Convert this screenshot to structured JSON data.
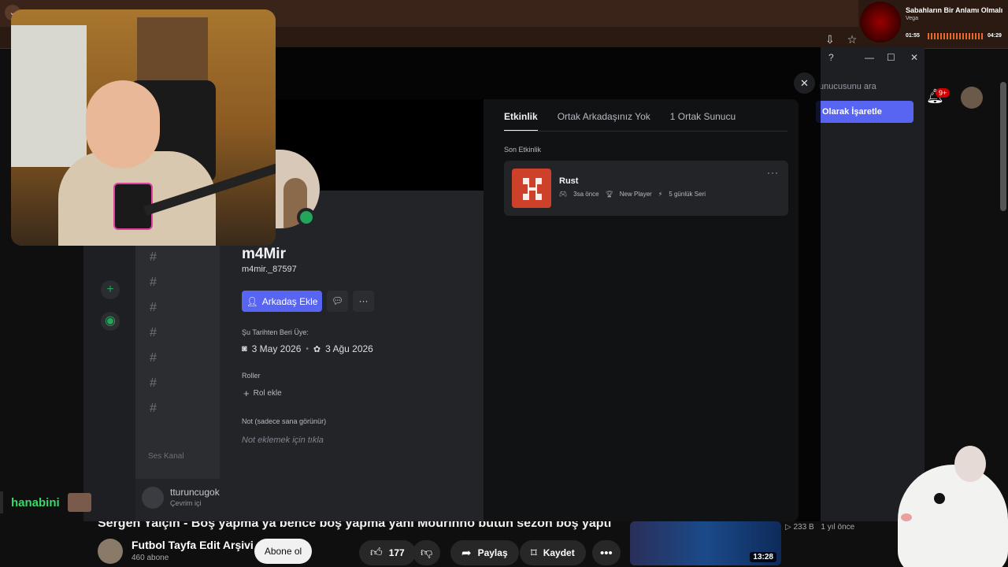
{
  "music": {
    "title": "Sabahların Bir Anlamı Olmalı",
    "artist": "Vega",
    "current": "01:55",
    "total": "04:29"
  },
  "discord_bg": {
    "search_placeholder": "unucusunu ara",
    "mark_label": "Olarak İşaretle",
    "voice_section": "Ses Kanal",
    "user_name": "tturuncugok",
    "user_status": "Çevrim içi"
  },
  "profile": {
    "display_name": "m4Mir",
    "username": "m4mir._87597",
    "add_friend_label": "Arkadaş Ekle",
    "member_since_label": "Şu Tarihten Beri Üye:",
    "discord_date": "3 May 2026",
    "server_date": "3 Ağu 2026",
    "roles_label": "Roller",
    "add_role_label": "Rol ekle",
    "note_label": "Not (sadece sana görünür)",
    "note_placeholder": "Not eklemek için tıkla",
    "status_color": "#23a55a",
    "accent": "#5865f2"
  },
  "tabs": [
    {
      "label": "Etkinlik",
      "active": true
    },
    {
      "label": "Ortak Arkadaşınız Yok",
      "active": false
    },
    {
      "label": "1 Ortak Sunucu",
      "active": false
    }
  ],
  "activity": {
    "section_label": "Son Etkinlik",
    "game": "Rust",
    "time": "3sa önce",
    "achievement": "New Player",
    "streak": "5 günlük Seri",
    "icon_color": "#cd412b"
  },
  "youtube": {
    "video_title": "Sergen Yalçın - Boş yapma ya bence boş yapma yani Mourinho bütün sezon boş yaptı",
    "channel_name": "Futbol Tayfa Edit Arşivi",
    "subscribers": "460 abone",
    "subscribe_label": "Abone ol",
    "likes": "177",
    "share_label": "Paylaş",
    "save_label": "Kaydet",
    "notif_count": "9+",
    "rec_duration": "13:28",
    "rec_views": "233 B",
    "rec_age": "1 yıl önce"
  },
  "chat": {
    "username": "hanabini"
  }
}
